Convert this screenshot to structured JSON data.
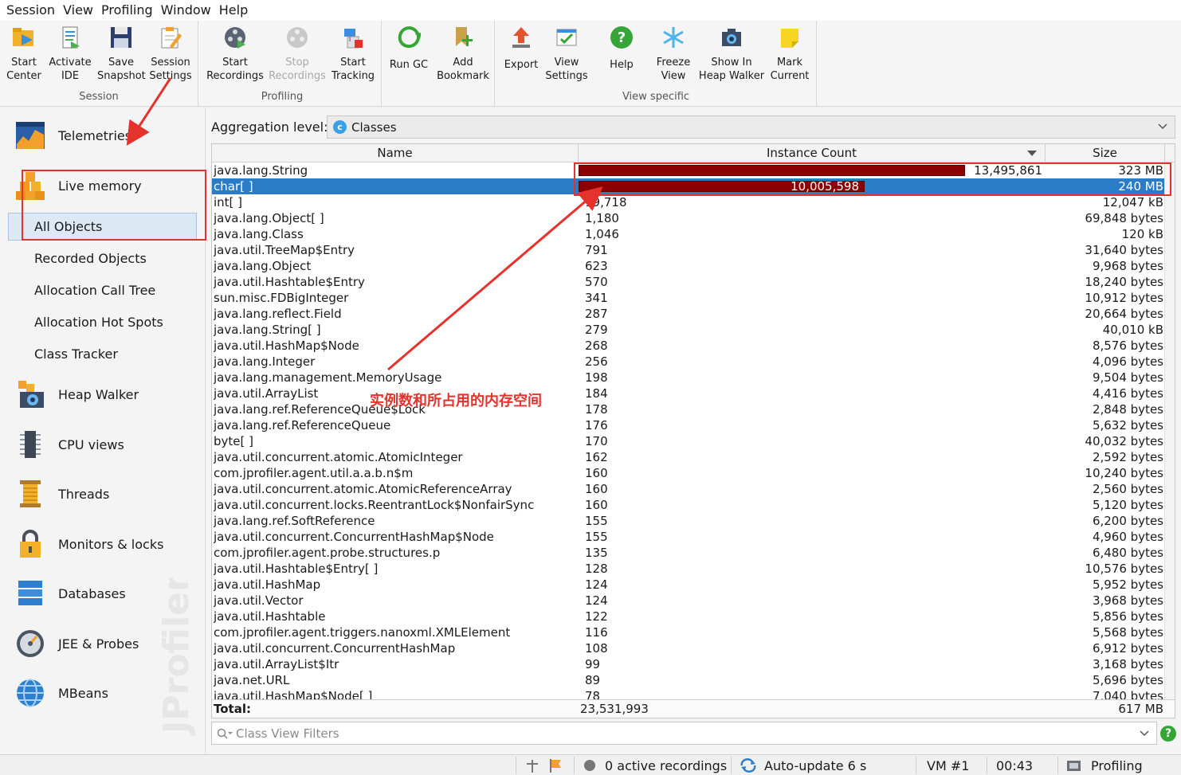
{
  "menu": [
    "Session",
    "View",
    "Profiling",
    "Window",
    "Help"
  ],
  "toolbar": {
    "groups": {
      "session": "Session",
      "profiling": "Profiling",
      "view_specific": "View specific"
    },
    "start_center": [
      "Start",
      "Center"
    ],
    "activate_ide": [
      "Activate",
      "IDE"
    ],
    "save_snapshot": [
      "Save",
      "Snapshot"
    ],
    "session_settings": [
      "Session",
      "Settings"
    ],
    "start_recordings": [
      "Start",
      "Recordings"
    ],
    "stop_recordings": [
      "Stop",
      "Recordings"
    ],
    "start_tracking": [
      "Start",
      "Tracking"
    ],
    "run_gc": "Run GC",
    "add_bookmark": [
      "Add",
      "Bookmark"
    ],
    "export": "Export",
    "view_settings": [
      "View",
      "Settings"
    ],
    "help": "Help",
    "freeze_view": [
      "Freeze",
      "View"
    ],
    "show_in_heap_walker": [
      "Show In",
      "Heap Walker"
    ],
    "mark_current": [
      "Mark",
      "Current"
    ]
  },
  "sidebar": {
    "telemetries": "Telemetries",
    "live_memory": "Live memory",
    "sub": [
      "All Objects",
      "Recorded Objects",
      "Allocation Call Tree",
      "Allocation Hot Spots",
      "Class Tracker"
    ],
    "heap_walker": "Heap Walker",
    "cpu_views": "CPU views",
    "threads": "Threads",
    "monitors": "Monitors & locks",
    "databases": "Databases",
    "jee": "JEE & Probes",
    "mbeans": "MBeans",
    "watermark": "JProfiler"
  },
  "aggregation": {
    "label": "Aggregation level:",
    "value": "Classes"
  },
  "table": {
    "columns": {
      "name": "Name",
      "count": "Instance Count",
      "size": "Size"
    },
    "rows": [
      {
        "name": "java.lang.String",
        "count": "13,495,861",
        "size": "323 MB",
        "bar": 1.0
      },
      {
        "name": "char[ ]",
        "count": "10,005,598",
        "size": "240 MB",
        "bar": 0.741,
        "selected": true
      },
      {
        "name": "int[ ]",
        "count": "19,718",
        "size": "12,047 kB"
      },
      {
        "name": "java.lang.Object[ ]",
        "count": "1,180",
        "size": "69,848 bytes"
      },
      {
        "name": "java.lang.Class",
        "count": "1,046",
        "size": "120 kB"
      },
      {
        "name": "java.util.TreeMap$Entry",
        "count": "791",
        "size": "31,640 bytes"
      },
      {
        "name": "java.lang.Object",
        "count": "623",
        "size": "9,968 bytes"
      },
      {
        "name": "java.util.Hashtable$Entry",
        "count": "570",
        "size": "18,240 bytes"
      },
      {
        "name": "sun.misc.FDBigInteger",
        "count": "341",
        "size": "10,912 bytes"
      },
      {
        "name": "java.lang.reflect.Field",
        "count": "287",
        "size": "20,664 bytes"
      },
      {
        "name": "java.lang.String[ ]",
        "count": "279",
        "size": "40,010 kB"
      },
      {
        "name": "java.util.HashMap$Node",
        "count": "268",
        "size": "8,576 bytes"
      },
      {
        "name": "java.lang.Integer",
        "count": "256",
        "size": "4,096 bytes"
      },
      {
        "name": "java.lang.management.MemoryUsage",
        "count": "198",
        "size": "9,504 bytes"
      },
      {
        "name": "java.util.ArrayList",
        "count": "184",
        "size": "4,416 bytes"
      },
      {
        "name": "java.lang.ref.ReferenceQueue$Lock",
        "count": "178",
        "size": "2,848 bytes"
      },
      {
        "name": "java.lang.ref.ReferenceQueue",
        "count": "176",
        "size": "5,632 bytes"
      },
      {
        "name": "byte[ ]",
        "count": "170",
        "size": "40,032 bytes"
      },
      {
        "name": "java.util.concurrent.atomic.AtomicInteger",
        "count": "162",
        "size": "2,592 bytes"
      },
      {
        "name": "com.jprofiler.agent.util.a.a.b.n$m",
        "count": "160",
        "size": "10,240 bytes"
      },
      {
        "name": "java.util.concurrent.atomic.AtomicReferenceArray",
        "count": "160",
        "size": "2,560 bytes"
      },
      {
        "name": "java.util.concurrent.locks.ReentrantLock$NonfairSync",
        "count": "160",
        "size": "5,120 bytes"
      },
      {
        "name": "java.lang.ref.SoftReference",
        "count": "155",
        "size": "6,200 bytes"
      },
      {
        "name": "java.util.concurrent.ConcurrentHashMap$Node",
        "count": "155",
        "size": "4,960 bytes"
      },
      {
        "name": "com.jprofiler.agent.probe.structures.p",
        "count": "135",
        "size": "6,480 bytes"
      },
      {
        "name": "java.util.Hashtable$Entry[ ]",
        "count": "128",
        "size": "10,576 bytes"
      },
      {
        "name": "java.util.HashMap",
        "count": "124",
        "size": "5,952 bytes"
      },
      {
        "name": "java.util.Vector",
        "count": "124",
        "size": "3,968 bytes"
      },
      {
        "name": "java.util.Hashtable",
        "count": "122",
        "size": "5,856 bytes"
      },
      {
        "name": "com.jprofiler.agent.triggers.nanoxml.XMLElement",
        "count": "116",
        "size": "5,568 bytes"
      },
      {
        "name": "java.util.concurrent.ConcurrentHashMap",
        "count": "108",
        "size": "6,912 bytes"
      },
      {
        "name": "java.util.ArrayList$Itr",
        "count": "99",
        "size": "3,168 bytes"
      },
      {
        "name": "java.net.URL",
        "count": "89",
        "size": "5,696 bytes"
      },
      {
        "name": "java.util.HashMap$Node[ ]",
        "count": "78",
        "size": "7,040 bytes"
      }
    ],
    "total": {
      "label": "Total:",
      "count": "23,531,993",
      "size": "617 MB"
    }
  },
  "filter": {
    "placeholder": "Class View Filters"
  },
  "statusbar": {
    "recordings": "0 active recordings",
    "auto_update": "Auto-update 6 s",
    "vm": "VM #1",
    "time": "00:43",
    "mode": "Profiling"
  },
  "annotation": "实例数和所占用的内存空间",
  "colors": {
    "selection": "#2a7cc6",
    "bar": "#8b0000",
    "annotation": "#e5322d"
  }
}
